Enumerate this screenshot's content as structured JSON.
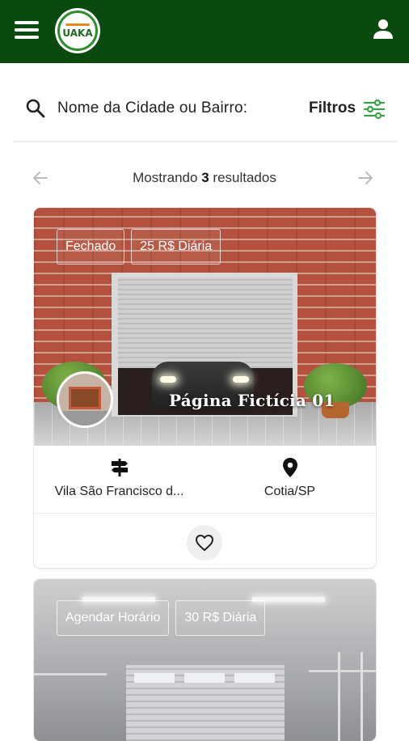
{
  "header": {
    "menu_icon": "hamburger-menu-icon",
    "logo_text": "UAKA",
    "user_icon": "user-account-icon",
    "bar_color": "#0b4a0f"
  },
  "search": {
    "icon": "search-icon",
    "label": "Nome da Cidade ou Bairro:",
    "filters_label": "Filtros",
    "filters_icon": "filter-sliders-icon",
    "filters_icon_color": "#3aa14a"
  },
  "pagination": {
    "prefix": "Mostrando",
    "count": "3",
    "suffix": "resultados",
    "prev_icon": "arrow-left-icon",
    "next_icon": "arrow-right-icon"
  },
  "listings": [
    {
      "status": "Fechado",
      "price": "25 R$ Diária",
      "title": "Página Fictícia 01",
      "street": "Vila São Francisco d...",
      "street_icon": "signpost-icon",
      "city": "Cotia/SP",
      "city_icon": "map-pin-icon",
      "favorite_icon": "heart-outline-icon"
    },
    {
      "status": "Agendar Horário",
      "price": "30 R$ Diária"
    }
  ]
}
